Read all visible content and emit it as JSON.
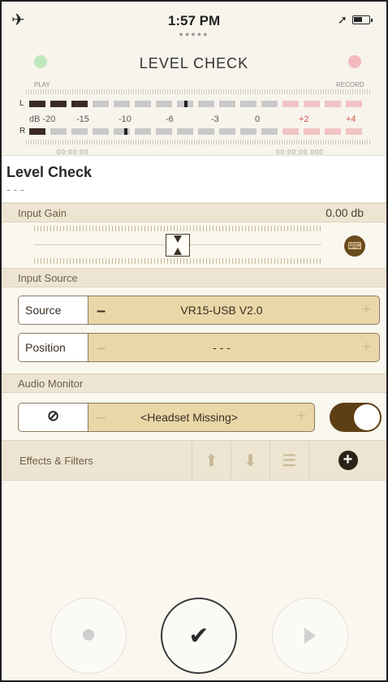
{
  "status_bar": {
    "time": "1:57 PM",
    "page_dots": "●●●●●"
  },
  "meter": {
    "title": "LEVEL CHECK",
    "play_label": "PLAY",
    "record_label": "RECORD",
    "left_channel": "L",
    "right_channel": "R",
    "scale": [
      "dB -20",
      "-15",
      "-10",
      "-6",
      "-3",
      "0",
      "+2",
      "+4"
    ],
    "footer_left": "00:00:00",
    "footer_right": "00:00:00.000"
  },
  "level_check": {
    "title": "Level Check",
    "subtitle": "- - -"
  },
  "input_gain": {
    "label": "Input Gain",
    "value": "0.00 db",
    "level": 0.5
  },
  "input_source": {
    "label": "Input Source",
    "source_key": "Source",
    "source_value": "VR15-USB V2.0",
    "position_key": "Position",
    "position_value": "- - -"
  },
  "audio_monitor": {
    "label": "Audio Monitor",
    "value": "<Headset Missing>",
    "toggle_on": true
  },
  "effects": {
    "label": "Effects & Filters"
  },
  "colors": {
    "accent": "#5e3f14",
    "pill": "#e9d7a8",
    "section": "#ede5d2"
  },
  "icons": [
    "airplane-icon",
    "location-icon",
    "battery-icon",
    "keyboard-icon",
    "no-entry-icon",
    "upload-icon",
    "download-icon",
    "list-icon",
    "add-icon",
    "record-icon",
    "checkmark-icon",
    "play-icon"
  ]
}
